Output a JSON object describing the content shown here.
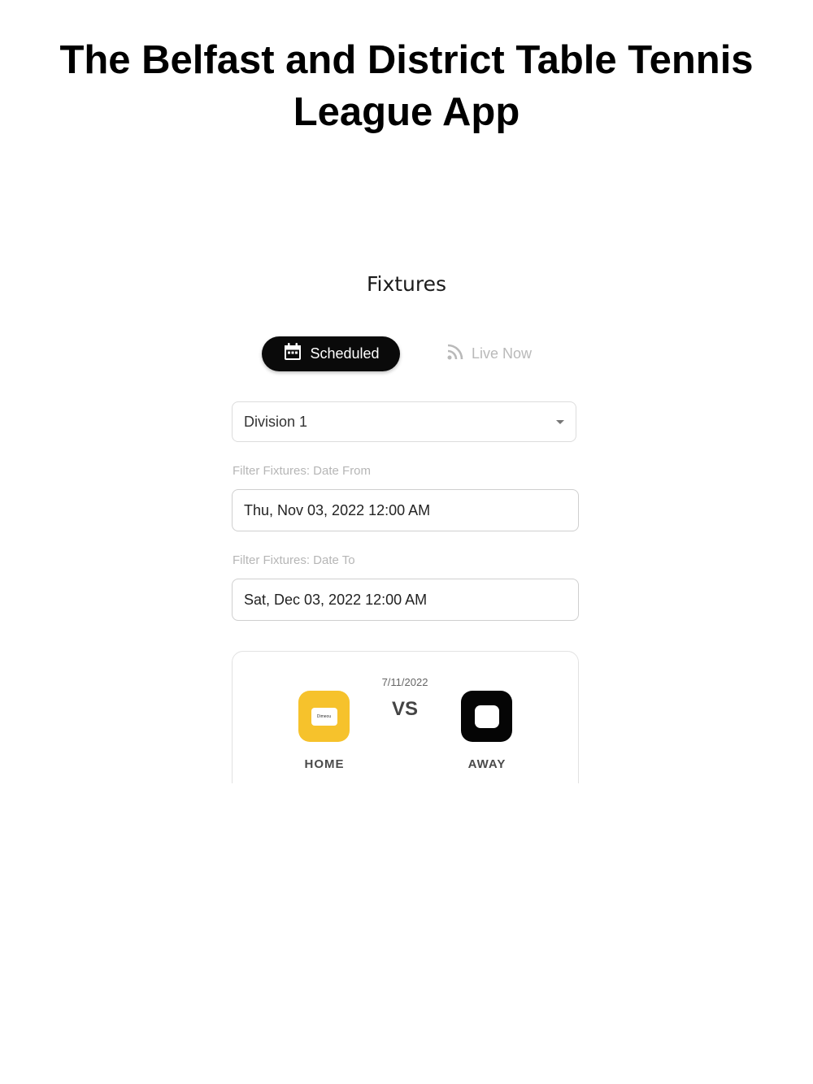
{
  "headline": "The Belfast and District Table Tennis League App",
  "screen": {
    "title": "Fixtures",
    "tabs": {
      "scheduled": "Scheduled",
      "live": "Live Now"
    },
    "division_select": {
      "value": "Division 1"
    },
    "date_from": {
      "label": "Filter Fixtures: Date From",
      "value": "Thu, Nov 03, 2022 12:00 AM"
    },
    "date_to": {
      "label": "Filter Fixtures: Date To",
      "value": "Sat, Dec 03, 2022 12:00 AM"
    },
    "fixture": {
      "date": "7/11/2022",
      "vs": "VS",
      "home_label": "HOME",
      "away_label": "AWAY",
      "home_logo_text": "Dimeou"
    }
  },
  "colors": {
    "active_tab_bg": "#0a0a0a",
    "inactive_tab_text": "#b9b9b9",
    "home_logo_bg": "#f6c22c",
    "away_logo_bg": "#050505"
  },
  "icons": {
    "scheduled": "calendar-icon",
    "live": "rss-feed-icon",
    "dropdown": "caret-down-icon"
  }
}
